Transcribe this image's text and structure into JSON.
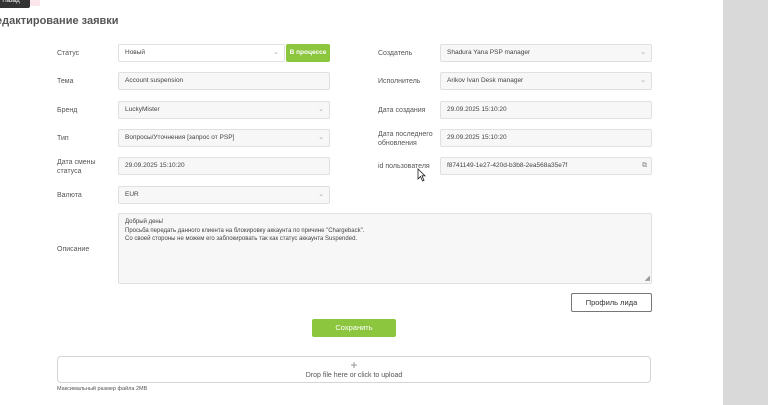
{
  "header": {
    "top_button": "Назад",
    "title": "едактирование заявки"
  },
  "form": {
    "status": {
      "label": "Статус",
      "value": "Новый",
      "button": "В процессе"
    },
    "theme": {
      "label": "Тема",
      "value": "Account suspension"
    },
    "brand": {
      "label": "Бренд",
      "value": "LuckyMister"
    },
    "type": {
      "label": "Тип",
      "value": "Вопросы/Уточнения [запрос от PSP]"
    },
    "status_change_date": {
      "label": "Дата смены статуса",
      "value": "29.09.2025 15:10:20"
    },
    "currency": {
      "label": "Валюта",
      "value": "EUR"
    },
    "creator": {
      "label": "Создатель",
      "value": "Shadura Yana PSP manager"
    },
    "executor": {
      "label": "Исполнитель",
      "value": "Arikov Ivan Desk manager"
    },
    "created_date": {
      "label": "Дата создания",
      "value": "29.09.2025 15:10:20"
    },
    "updated_date": {
      "label": "Дата последнего обновления",
      "value": "29.09.2025 15:10:20"
    },
    "user_id": {
      "label": "id пользователя",
      "value": "f8741149-1e27-420d-b3b8-2ea568a35e7f"
    },
    "description": {
      "label": "Описание",
      "lines": [
        "Добрый день!",
        "Просьба передать данного клиента на блокировку аккаунта по причине \"Chargeback\".",
        "Со своей стороны не можем его заблокировать так как статус аккаунта Suspended."
      ]
    }
  },
  "actions": {
    "lead_profile": "Профиль лида",
    "save": "Сохранить"
  },
  "upload": {
    "plus": "+",
    "text": "Drop file here or click to upload",
    "max_size": "Максимальный размер файла 2MB"
  },
  "icons": {
    "chevron": "chevron-down-icon",
    "copy": "copy-icon",
    "cursor": "mouse-cursor-icon"
  },
  "colors": {
    "accent": "#8cc63f",
    "background": "#d9d9d9"
  }
}
